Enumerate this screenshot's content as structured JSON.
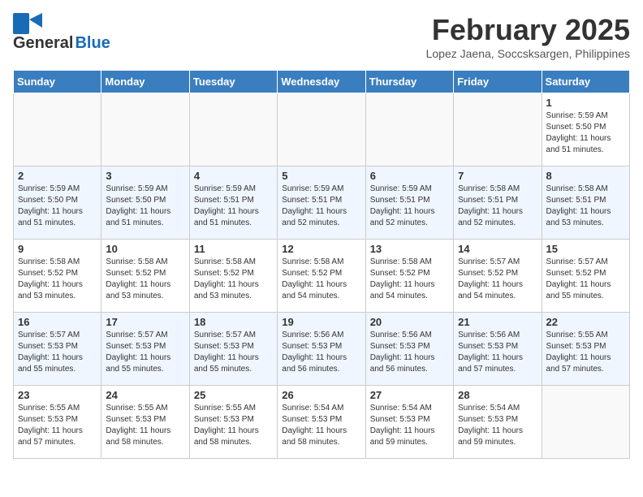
{
  "header": {
    "logo_line1": "General",
    "logo_line2": "Blue",
    "month_title": "February 2025",
    "location": "Lopez Jaena, Soccsksargen, Philippines"
  },
  "days_of_week": [
    "Sunday",
    "Monday",
    "Tuesday",
    "Wednesday",
    "Thursday",
    "Friday",
    "Saturday"
  ],
  "weeks": [
    [
      {
        "day": "",
        "info": ""
      },
      {
        "day": "",
        "info": ""
      },
      {
        "day": "",
        "info": ""
      },
      {
        "day": "",
        "info": ""
      },
      {
        "day": "",
        "info": ""
      },
      {
        "day": "",
        "info": ""
      },
      {
        "day": "1",
        "info": "Sunrise: 5:59 AM\nSunset: 5:50 PM\nDaylight: 11 hours\nand 51 minutes."
      }
    ],
    [
      {
        "day": "2",
        "info": "Sunrise: 5:59 AM\nSunset: 5:50 PM\nDaylight: 11 hours\nand 51 minutes."
      },
      {
        "day": "3",
        "info": "Sunrise: 5:59 AM\nSunset: 5:50 PM\nDaylight: 11 hours\nand 51 minutes."
      },
      {
        "day": "4",
        "info": "Sunrise: 5:59 AM\nSunset: 5:51 PM\nDaylight: 11 hours\nand 51 minutes."
      },
      {
        "day": "5",
        "info": "Sunrise: 5:59 AM\nSunset: 5:51 PM\nDaylight: 11 hours\nand 52 minutes."
      },
      {
        "day": "6",
        "info": "Sunrise: 5:59 AM\nSunset: 5:51 PM\nDaylight: 11 hours\nand 52 minutes."
      },
      {
        "day": "7",
        "info": "Sunrise: 5:58 AM\nSunset: 5:51 PM\nDaylight: 11 hours\nand 52 minutes."
      },
      {
        "day": "8",
        "info": "Sunrise: 5:58 AM\nSunset: 5:51 PM\nDaylight: 11 hours\nand 53 minutes."
      }
    ],
    [
      {
        "day": "9",
        "info": "Sunrise: 5:58 AM\nSunset: 5:52 PM\nDaylight: 11 hours\nand 53 minutes."
      },
      {
        "day": "10",
        "info": "Sunrise: 5:58 AM\nSunset: 5:52 PM\nDaylight: 11 hours\nand 53 minutes."
      },
      {
        "day": "11",
        "info": "Sunrise: 5:58 AM\nSunset: 5:52 PM\nDaylight: 11 hours\nand 53 minutes."
      },
      {
        "day": "12",
        "info": "Sunrise: 5:58 AM\nSunset: 5:52 PM\nDaylight: 11 hours\nand 54 minutes."
      },
      {
        "day": "13",
        "info": "Sunrise: 5:58 AM\nSunset: 5:52 PM\nDaylight: 11 hours\nand 54 minutes."
      },
      {
        "day": "14",
        "info": "Sunrise: 5:57 AM\nSunset: 5:52 PM\nDaylight: 11 hours\nand 54 minutes."
      },
      {
        "day": "15",
        "info": "Sunrise: 5:57 AM\nSunset: 5:52 PM\nDaylight: 11 hours\nand 55 minutes."
      }
    ],
    [
      {
        "day": "16",
        "info": "Sunrise: 5:57 AM\nSunset: 5:53 PM\nDaylight: 11 hours\nand 55 minutes."
      },
      {
        "day": "17",
        "info": "Sunrise: 5:57 AM\nSunset: 5:53 PM\nDaylight: 11 hours\nand 55 minutes."
      },
      {
        "day": "18",
        "info": "Sunrise: 5:57 AM\nSunset: 5:53 PM\nDaylight: 11 hours\nand 55 minutes."
      },
      {
        "day": "19",
        "info": "Sunrise: 5:56 AM\nSunset: 5:53 PM\nDaylight: 11 hours\nand 56 minutes."
      },
      {
        "day": "20",
        "info": "Sunrise: 5:56 AM\nSunset: 5:53 PM\nDaylight: 11 hours\nand 56 minutes."
      },
      {
        "day": "21",
        "info": "Sunrise: 5:56 AM\nSunset: 5:53 PM\nDaylight: 11 hours\nand 57 minutes."
      },
      {
        "day": "22",
        "info": "Sunrise: 5:55 AM\nSunset: 5:53 PM\nDaylight: 11 hours\nand 57 minutes."
      }
    ],
    [
      {
        "day": "23",
        "info": "Sunrise: 5:55 AM\nSunset: 5:53 PM\nDaylight: 11 hours\nand 57 minutes."
      },
      {
        "day": "24",
        "info": "Sunrise: 5:55 AM\nSunset: 5:53 PM\nDaylight: 11 hours\nand 58 minutes."
      },
      {
        "day": "25",
        "info": "Sunrise: 5:55 AM\nSunset: 5:53 PM\nDaylight: 11 hours\nand 58 minutes."
      },
      {
        "day": "26",
        "info": "Sunrise: 5:54 AM\nSunset: 5:53 PM\nDaylight: 11 hours\nand 58 minutes."
      },
      {
        "day": "27",
        "info": "Sunrise: 5:54 AM\nSunset: 5:53 PM\nDaylight: 11 hours\nand 59 minutes."
      },
      {
        "day": "28",
        "info": "Sunrise: 5:54 AM\nSunset: 5:53 PM\nDaylight: 11 hours\nand 59 minutes."
      },
      {
        "day": "",
        "info": ""
      }
    ]
  ]
}
